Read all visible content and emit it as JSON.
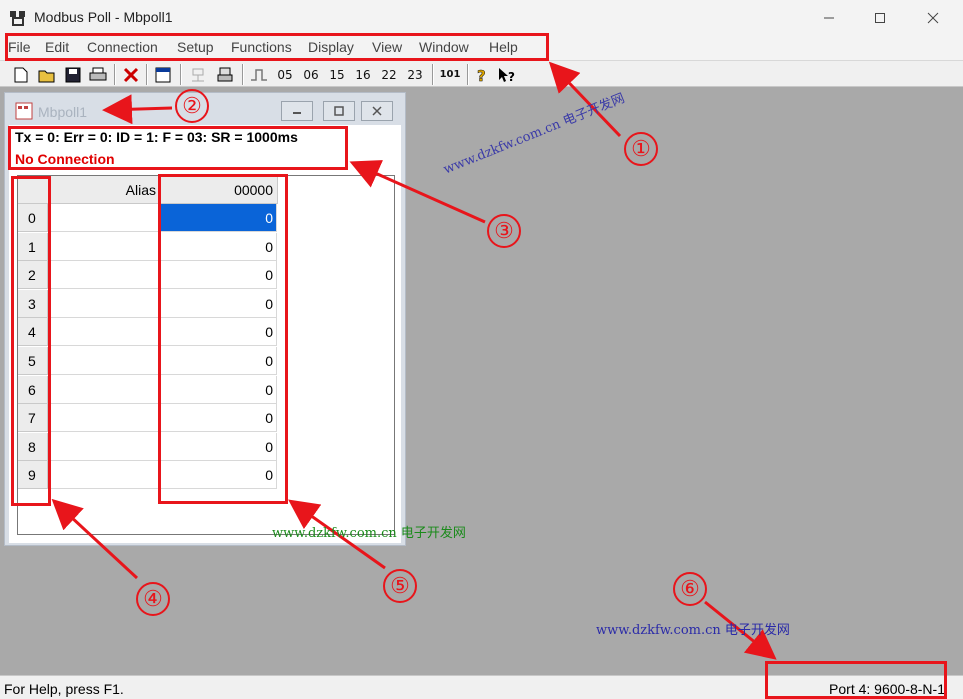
{
  "window": {
    "title": "Modbus Poll - Mbpoll1"
  },
  "menu": [
    "File",
    "Edit",
    "Connection",
    "Setup",
    "Functions",
    "Display",
    "View",
    "Window",
    "Help"
  ],
  "toolbar": {
    "func_codes": [
      "05",
      "06",
      "15",
      "16",
      "22",
      "23"
    ],
    "num_label": "101"
  },
  "child": {
    "title": "Mbpoll1",
    "status_line": "Tx = 0: Err = 0: ID = 1: F = 03: SR = 1000ms",
    "connection": "No Connection"
  },
  "grid": {
    "headers": {
      "alias": "Alias",
      "value": "00000"
    },
    "rows": [
      {
        "index": "0",
        "value": "0"
      },
      {
        "index": "1",
        "value": "0"
      },
      {
        "index": "2",
        "value": "0"
      },
      {
        "index": "3",
        "value": "0"
      },
      {
        "index": "4",
        "value": "0"
      },
      {
        "index": "5",
        "value": "0"
      },
      {
        "index": "6",
        "value": "0"
      },
      {
        "index": "7",
        "value": "0"
      },
      {
        "index": "8",
        "value": "0"
      },
      {
        "index": "9",
        "value": "0"
      }
    ]
  },
  "statusbar": {
    "help": "For Help, press F1.",
    "port": "Port 4: 9600-8-N-1"
  },
  "annotations": {
    "numbers": [
      "①",
      "②",
      "③",
      "④",
      "⑤",
      "⑥"
    ]
  },
  "watermark": {
    "text": "www.dzkfw.com.cn 电子开发网"
  },
  "colors": {
    "annotation": "#e8151b",
    "selection": "#0a64d8",
    "error": "#e00000",
    "workspace": "#a9a9a9"
  }
}
